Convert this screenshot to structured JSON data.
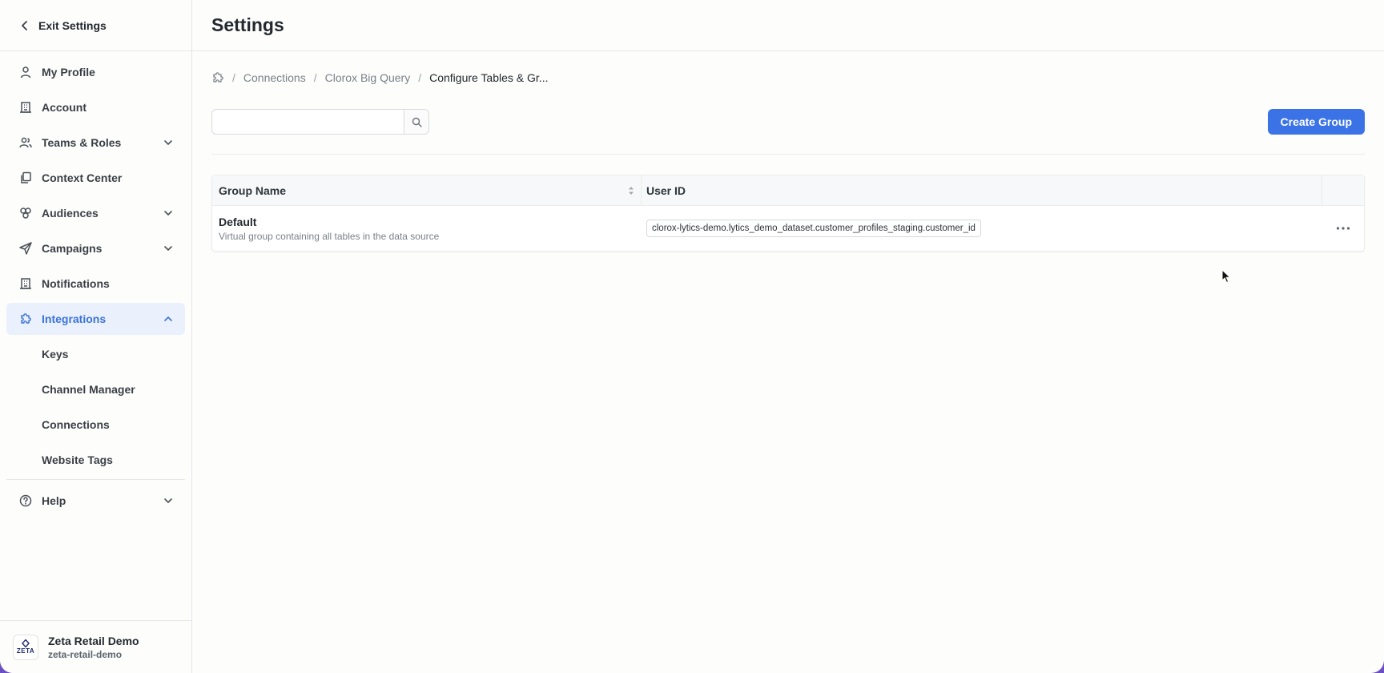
{
  "sidebar": {
    "exit_label": "Exit Settings",
    "items": [
      {
        "label": "My Profile"
      },
      {
        "label": "Account"
      },
      {
        "label": "Teams & Roles"
      },
      {
        "label": "Context Center"
      },
      {
        "label": "Audiences"
      },
      {
        "label": "Campaigns"
      },
      {
        "label": "Notifications"
      },
      {
        "label": "Integrations"
      }
    ],
    "sub_items": [
      {
        "label": "Keys"
      },
      {
        "label": "Channel Manager"
      },
      {
        "label": "Connections"
      },
      {
        "label": "Website Tags"
      }
    ],
    "help_label": "Help",
    "org": {
      "logo_text": "ZETA",
      "name": "Zeta Retail Demo",
      "slug": "zeta-retail-demo"
    }
  },
  "header": {
    "title": "Settings"
  },
  "breadcrumb": {
    "items": [
      "Connections",
      "Clorox Big Query"
    ],
    "current": "Configure Tables & Gr...",
    "separator": "/"
  },
  "search": {
    "value": "",
    "placeholder": ""
  },
  "actions": {
    "create_label": "Create Group"
  },
  "table": {
    "columns": [
      "Group Name",
      "User ID"
    ],
    "rows": [
      {
        "name": "Default",
        "description": "Virtual group containing all tables in the data source",
        "user_id": "clorox-lytics-demo.lytics_demo_dataset.customer_profiles_staging.customer_id"
      }
    ]
  },
  "colors": {
    "accent": "#3b73e6",
    "active_bg": "#eaf1fc",
    "active_text": "#3b73d9"
  }
}
